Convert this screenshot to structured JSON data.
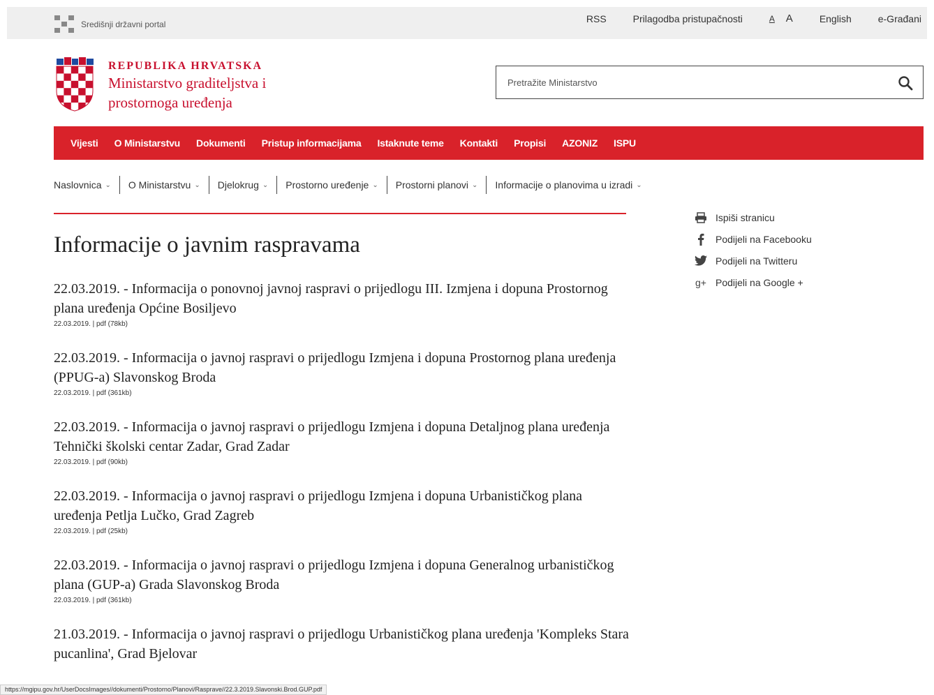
{
  "top_bar": {
    "portal_label": "Središnji državni portal",
    "links": {
      "rss": "RSS",
      "accessibility": "Prilagodba pristupačnosti",
      "font_small": "A",
      "font_large": "A",
      "english": "English",
      "egradjani": "e-Građani"
    }
  },
  "header": {
    "country": "REPUBLIKA HRVATSKA",
    "ministry_line1": "Ministarstvo graditeljstva i",
    "ministry_line2": "prostornoga uređenja",
    "search_placeholder": "Pretražite Ministarstvo"
  },
  "main_nav": [
    "Vijesti",
    "O Ministarstvu",
    "Dokumenti",
    "Pristup informacijama",
    "Istaknute teme",
    "Kontakti",
    "Propisi",
    "AZONIZ",
    "ISPU"
  ],
  "sub_nav": [
    "Naslovnica",
    "O Ministarstvu",
    "Djelokrug",
    "Prostorno uređenje",
    "Prostorni planovi",
    "Informacije o planovima u izradi"
  ],
  "page_title": "Informacije o javnim raspravama",
  "articles": [
    {
      "title": "22.03.2019. - Informacija o ponovnoj javnoj raspravi o prijedlogu III. Izmjena i dopuna Prostornog plana uređenja Općine Bosiljevo",
      "meta": "22.03.2019. | pdf (78kb)"
    },
    {
      "title": "22.03.2019. - Informacija o javnoj raspravi o prijedlogu Izmjena i dopuna Prostornog plana uređenja (PPUG-a) Slavonskog Broda",
      "meta": "22.03.2019. | pdf (361kb)"
    },
    {
      "title": "22.03.2019. - Informacija o javnoj raspravi o prijedlogu Izmjena i dopuna Detaljnog plana uređenja Tehnički školski centar Zadar, Grad Zadar",
      "meta": "22.03.2019. | pdf (90kb)"
    },
    {
      "title": "22.03.2019. - Informacija o javnoj raspravi o prijedlogu Izmjena i dopuna Urbanističkog plana uređenja Petlja Lučko, Grad Zagreb",
      "meta": "22.03.2019. | pdf (25kb)"
    },
    {
      "title": "22.03.2019. - Informacija o javnoj raspravi o prijedlogu Izmjena i dopuna Generalnog urbanističkog plana (GUP-a) Grada Slavonskog Broda",
      "meta": "22.03.2019. | pdf (361kb)"
    },
    {
      "title": "21.03.2019. - Informacija o javnoj raspravi o prijedlogu Urbanističkog plana uređenja 'Kompleks Stara pucanlina', Grad Bjelovar",
      "meta": ""
    }
  ],
  "share": {
    "print": "Ispiši stranicu",
    "facebook": "Podijeli na Facebooku",
    "twitter": "Podijeli na Twitteru",
    "google": "Podijeli na Google +"
  },
  "status_url": "https://mgipu.gov.hr/UserDocsImages//dokumenti/Prostorno/Planovi/Rasprave//22.3.2019.Slavonski.Brod.GUP.pdf",
  "colors": {
    "brand_red": "#d9222a"
  }
}
